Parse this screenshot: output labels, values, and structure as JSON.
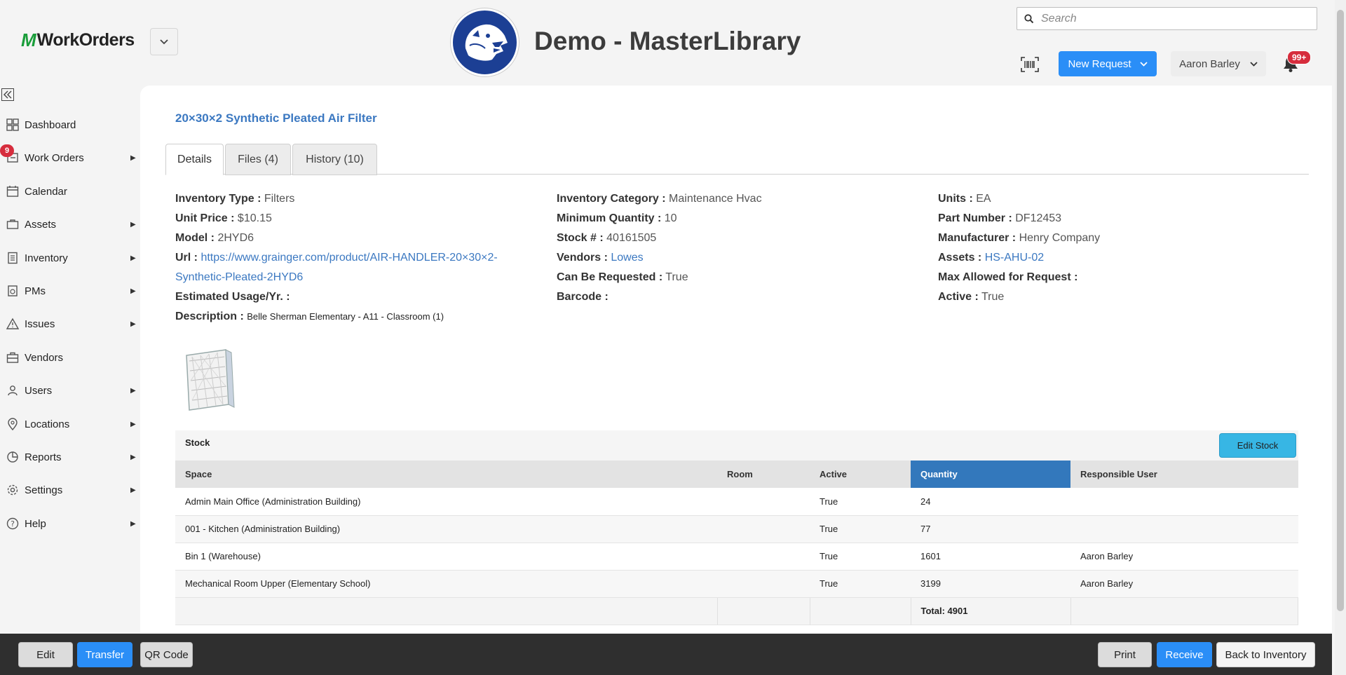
{
  "header": {
    "brand_name": "WorkOrders",
    "org_title": "Demo - MasterLibrary",
    "search_placeholder": "Search",
    "new_request_label": "New Request",
    "user_name": "Aaron Barley",
    "notification_count": "99+"
  },
  "sidebar": {
    "work_orders_badge": "9",
    "items": [
      {
        "label": "Dashboard",
        "icon": "dashboard-icon"
      },
      {
        "label": "Work Orders",
        "icon": "work-orders-icon"
      },
      {
        "label": "Calendar",
        "icon": "calendar-icon"
      },
      {
        "label": "Assets",
        "icon": "assets-icon"
      },
      {
        "label": "Inventory",
        "icon": "inventory-icon"
      },
      {
        "label": "PMs",
        "icon": "pms-icon"
      },
      {
        "label": "Issues",
        "icon": "warning-icon"
      },
      {
        "label": "Vendors",
        "icon": "briefcase-icon"
      },
      {
        "label": "Users",
        "icon": "users-icon"
      },
      {
        "label": "Locations",
        "icon": "location-pin-icon"
      },
      {
        "label": "Reports",
        "icon": "pie-chart-icon"
      },
      {
        "label": "Settings",
        "icon": "gear-icon"
      },
      {
        "label": "Help",
        "icon": "help-icon"
      }
    ]
  },
  "item": {
    "title": "20×30×2 Synthetic Pleated Air Filter",
    "tabs": [
      "Details",
      "Files (4)",
      "History (10)"
    ],
    "col1": {
      "inventory_type_label": "Inventory Type :",
      "inventory_type": "Filters",
      "unit_price_label": "Unit Price :",
      "unit_price": "$10.15",
      "model_label": "Model :",
      "model": "2HYD6",
      "url_label": "Url :",
      "url_line1": "https://www.grainger.com/product/AIR-HANDLER-20×30×2-",
      "url_line2": "Synthetic-Pleated-2HYD6",
      "usage_label": "Estimated Usage/Yr. :",
      "description_label": "Description :",
      "description": "Belle Sherman Elementary - A11 - Classroom (1)"
    },
    "col2": {
      "category_label": "Inventory Category :",
      "category": "Maintenance Hvac",
      "min_qty_label": "Minimum Quantity :",
      "min_qty": "10",
      "stock_no_label": "Stock # :",
      "stock_no": "40161505",
      "vendors_label": "Vendors :",
      "vendors": "Lowes",
      "requestable_label": "Can Be Requested :",
      "requestable": "True",
      "barcode_label": "Barcode :"
    },
    "col3": {
      "units_label": "Units :",
      "units": "EA",
      "part_label": "Part Number :",
      "part": "DF12453",
      "manufacturer_label": "Manufacturer :",
      "manufacturer": "Henry Company",
      "assets_label": "Assets :",
      "assets": "HS-AHU-02",
      "max_label": "Max Allowed for Request :",
      "active_label": "Active :",
      "active": "True"
    }
  },
  "stock": {
    "title": "Stock",
    "edit_label": "Edit Stock",
    "columns": [
      "Space",
      "Room",
      "Active",
      "Quantity",
      "Responsible User"
    ],
    "rows": [
      [
        "Admin Main Office (Administration Building)",
        "",
        "True",
        "24",
        ""
      ],
      [
        "001 - Kitchen (Administration Building)",
        "",
        "True",
        "77",
        ""
      ],
      [
        "Bin 1 (Warehouse)",
        "",
        "True",
        "1601",
        "Aaron Barley"
      ],
      [
        "Mechanical Room Upper (Elementary School)",
        "",
        "True",
        "3199",
        "Aaron Barley"
      ]
    ],
    "total": "Total: 4901"
  },
  "bottom_bar": {
    "edit": "Edit",
    "transfer": "Transfer",
    "qr_code": "QR Code",
    "print": "Print",
    "receive": "Receive",
    "back": "Back to Inventory"
  }
}
